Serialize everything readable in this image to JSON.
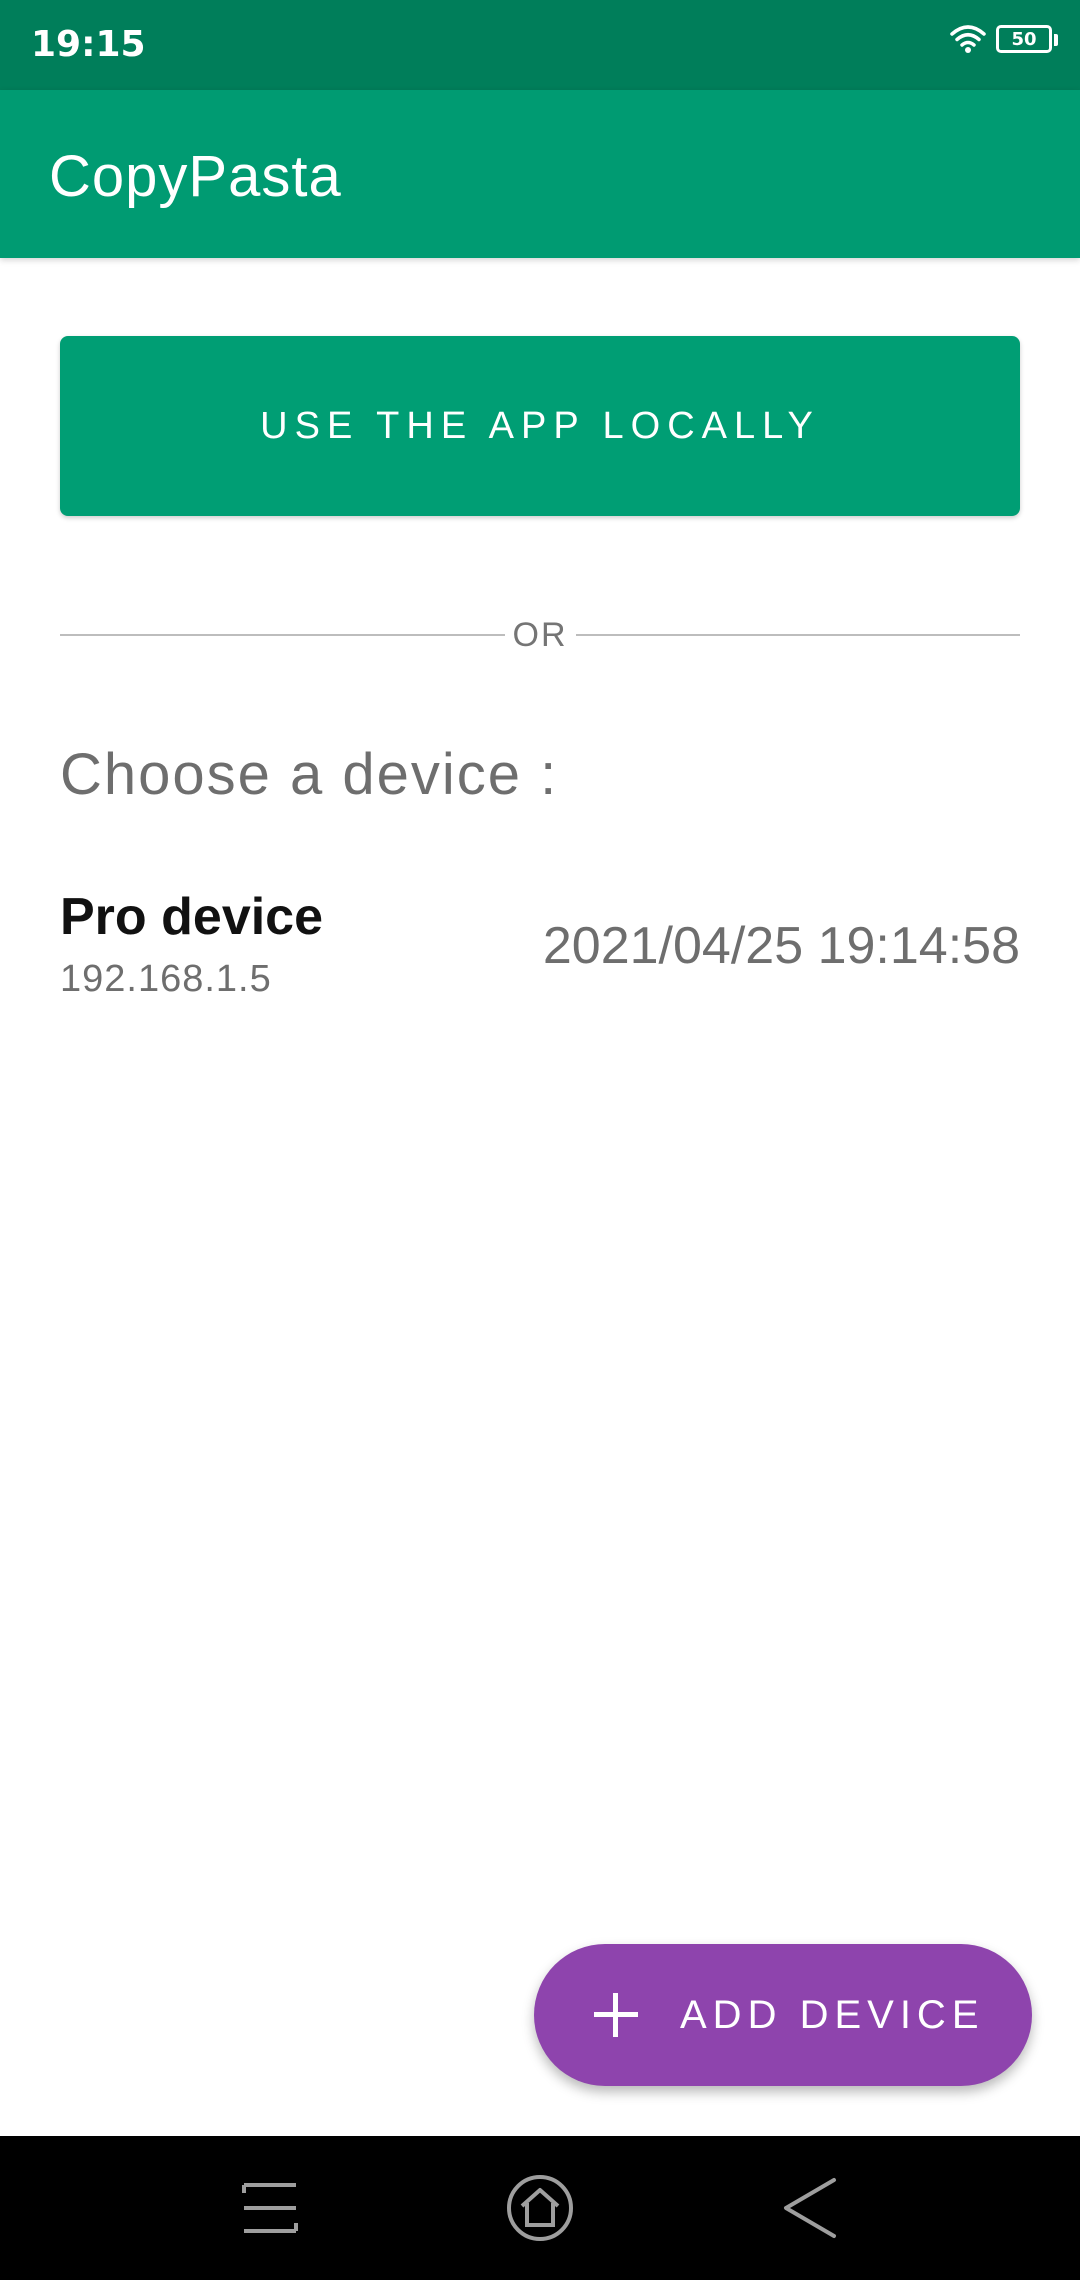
{
  "status_bar": {
    "time": "19:15",
    "battery_level": "50",
    "icons": [
      "wifi-icon",
      "battery-icon"
    ]
  },
  "app_bar": {
    "title": "CopyPasta"
  },
  "main": {
    "local_button_label": "USE THE APP LOCALLY",
    "divider_label": "OR",
    "choose_heading": "Choose a device :",
    "devices": [
      {
        "name": "Pro device",
        "ip": "192.168.1.5",
        "date": "2021/04/25 19:14:58"
      }
    ]
  },
  "fab": {
    "label": "ADD DEVICE",
    "icon": "plus-icon"
  },
  "nav_bar": {
    "buttons": [
      "menu-icon",
      "home-icon",
      "back-icon"
    ]
  },
  "colors": {
    "status_bar": "#007e5a",
    "app_bar": "#009b72",
    "primary_button": "#009e74",
    "fab": "#8e44ad",
    "secondary_text": "#6e6e6e"
  }
}
